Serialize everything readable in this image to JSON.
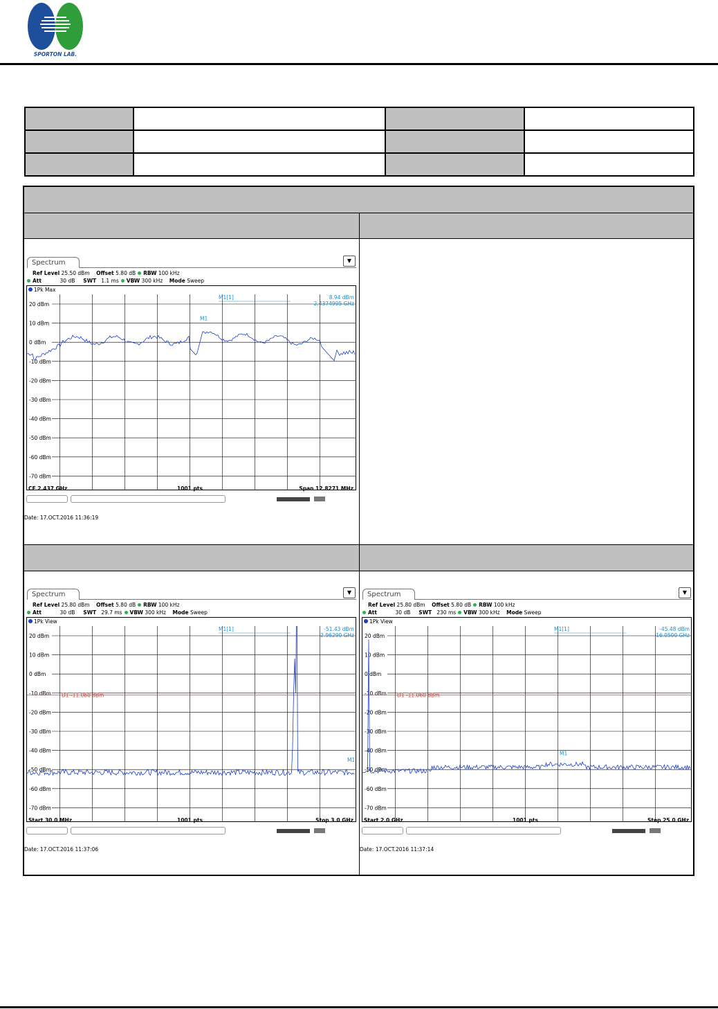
{
  "logo": {
    "text": "SPORTON LAB."
  },
  "plots": [
    {
      "tab": "Spectrum",
      "ref_level_label": "Ref Level",
      "ref_level": "25.50 dBm",
      "offset_label": "Offset",
      "offset": "5.80 dB",
      "rbw_label": "RBW",
      "rbw": "100 kHz",
      "att_label": "Att",
      "att": "30 dB",
      "swt_label": "SWT",
      "swt": "1.1 ms",
      "vbw_label": "VBW",
      "vbw": "300 kHz",
      "mode_label": "Mode",
      "mode": "Sweep",
      "trace": "1Pk Max",
      "marker_name": "M1[1]",
      "marker_value": "8.94 dBm",
      "marker_freq": "2.4374995 GHz",
      "marker_tag": "M1",
      "display_line": "",
      "footer_left": "CF 2.437 GHz",
      "footer_mid": "1001 pts",
      "footer_right": "Span 12.8271 MHz",
      "date": "Date: 17.OCT.2016  11:36:19"
    },
    {
      "tab": "Spectrum",
      "ref_level_label": "Ref Level",
      "ref_level": "25.80 dBm",
      "offset_label": "Offset",
      "offset": "5.80 dB",
      "rbw_label": "RBW",
      "rbw": "100 kHz",
      "att_label": "Att",
      "att": "30 dB",
      "swt_label": "SWT",
      "swt": "29.7 ms",
      "vbw_label": "VBW",
      "vbw": "300 kHz",
      "mode_label": "Mode",
      "mode": "Sweep",
      "trace": "1Pk View",
      "marker_name": "M1[1]",
      "marker_value": "-51.43 dBm",
      "marker_freq": "2.96290 GHz",
      "marker_tag": "M1",
      "display_line": "D1  -11.060 dBm",
      "footer_left": "Start 30.0 MHz",
      "footer_mid": "1001 pts",
      "footer_right": "Stop 3.0 GHz",
      "date": "Date: 17.OCT.2016  11:37:06"
    },
    {
      "tab": "Spectrum",
      "ref_level_label": "Ref Level",
      "ref_level": "25.80 dBm",
      "offset_label": "Offset",
      "offset": "5.80 dB",
      "rbw_label": "RBW",
      "rbw": "100 kHz",
      "att_label": "Att",
      "att": "30 dB",
      "swt_label": "SWT",
      "swt": "230 ms",
      "vbw_label": "VBW",
      "vbw": "300 kHz",
      "mode_label": "Mode",
      "mode": "Sweep",
      "trace": "1Pk View",
      "marker_name": "M1[1]",
      "marker_value": "-45.48 dBm",
      "marker_freq": "16.0500 GHz",
      "marker_tag": "M1",
      "display_line": "D1  -11.060 dBm",
      "footer_left": "Start 2.0 GHz",
      "footer_mid": "1001 pts",
      "footer_right": "Stop 25.0 GHz",
      "date": "Date: 17.OCT.2016  11:37:14"
    }
  ],
  "y_ticks": [
    "20 dBm",
    "10 dBm",
    "0 dBm",
    "-10 dBm",
    "-20 dBm",
    "-30 dBm",
    "-40 dBm",
    "-50 dBm",
    "-60 dBm",
    "-70 dBm"
  ],
  "colors": {
    "trace": "#1a3fcf",
    "marker": "#1a8fcf",
    "display_line": "#d23b2b",
    "header_gray": "#c0c0c0"
  }
}
